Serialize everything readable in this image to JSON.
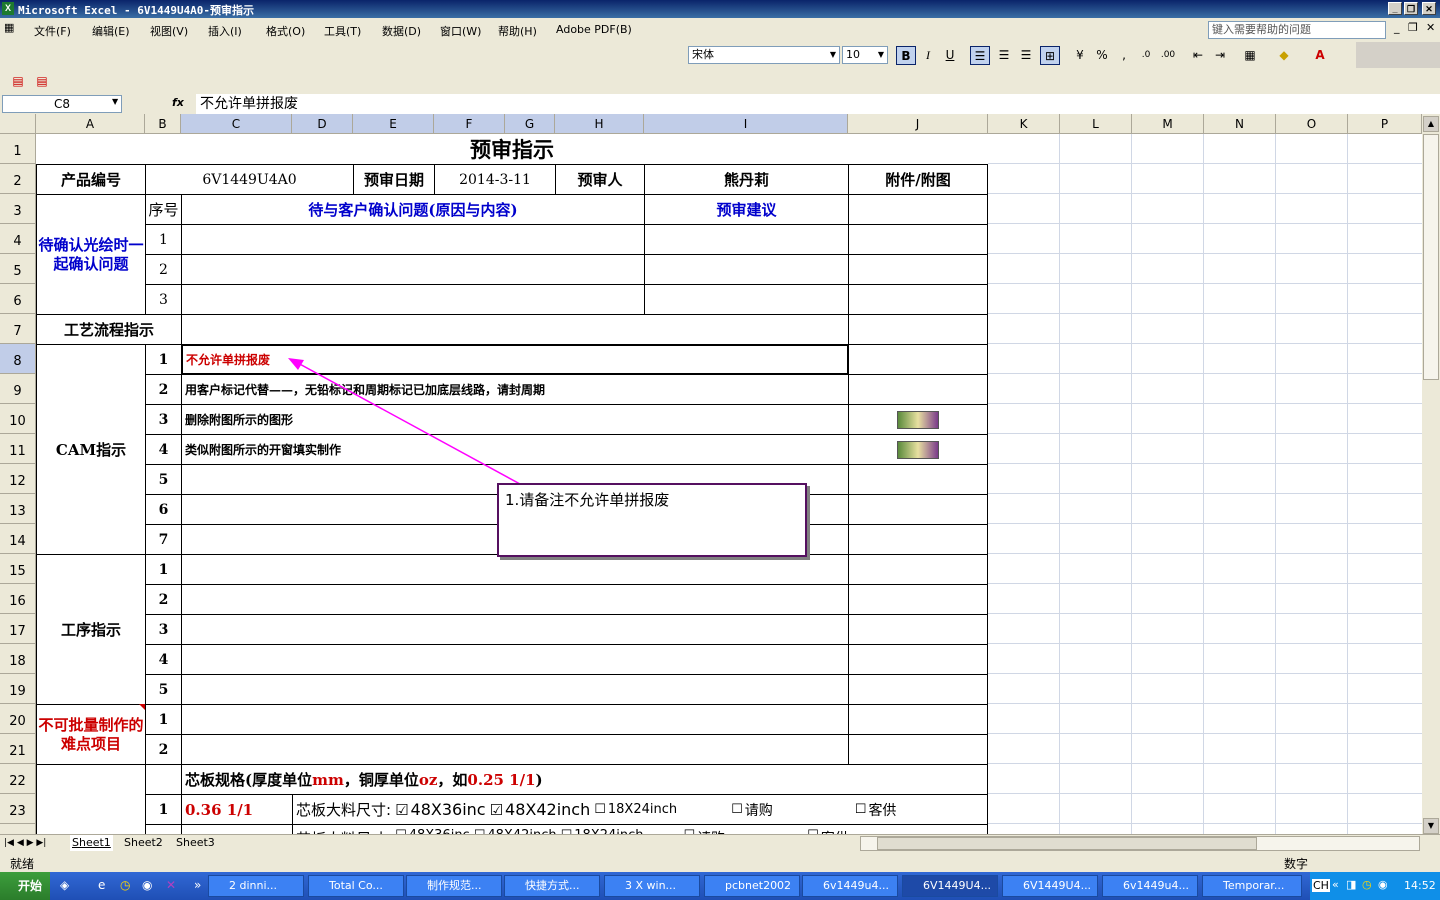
{
  "window": {
    "title": "Microsoft Excel - 6V1449U4A0-预审指示",
    "app_icon": "excel-icon"
  },
  "menu": {
    "items": [
      "文件(F)",
      "编辑(E)",
      "视图(V)",
      "插入(I)",
      "格式(O)",
      "工具(T)",
      "数据(D)",
      "窗口(W)",
      "帮助(H)",
      "Adobe PDF(B)"
    ],
    "help_placeholder": "键入需要帮助的问题"
  },
  "format_toolbar": {
    "font": "宋体",
    "size": "10",
    "bold": "B",
    "italic": "I",
    "underline": "U",
    "percent": "%",
    "comma": ","
  },
  "formula_bar": {
    "name_box": "C8",
    "fx": "fx",
    "content": "不允许单拼报废"
  },
  "columns": [
    "A",
    "B",
    "C",
    "D",
    "E",
    "F",
    "G",
    "H",
    "I",
    "J",
    "K",
    "L",
    "M",
    "N",
    "O",
    "P"
  ],
  "rows": [
    "1",
    "2",
    "3",
    "4",
    "5",
    "6",
    "7",
    "8",
    "9",
    "10",
    "11",
    "12",
    "13",
    "14",
    "15",
    "16",
    "17",
    "18",
    "19",
    "20",
    "21",
    "22",
    "23"
  ],
  "sheet": {
    "title": "预审指示",
    "product_label": "产品编号",
    "product_value": "6V1449U4A0",
    "date_label": "预审日期",
    "date_value": "2014-3-11",
    "reviewer_label": "预审人",
    "reviewer_value": "熊丹莉",
    "attachment_label": "附件/附图",
    "seq_label": "序号",
    "issue_header": "待与客户确认问题(原因与内容)",
    "suggest_header": "预审建议",
    "confirm_section": "待确认光绘时一起确认问题",
    "process_label": "工艺流程指示",
    "cam_section": "CAM指示",
    "cam_items": [
      "不允许单拼报废",
      "用客户标记代替——，无铅标记和周期标记已加底层线路，请封周期",
      "删除附图所示的图形",
      "类似附图所示的开窗填实制作"
    ],
    "proc_section": "工序指示",
    "hard_section": "不可批量制作的难点项目",
    "core_header_a": "芯板规格(厚度单位",
    "core_header_mm": "mm",
    "core_header_b": "，铜厚单位",
    "core_header_oz": "oz",
    "core_header_c": "，如",
    "core_header_ex": "0.25 1/1",
    "core_header_d": ")",
    "core_row1_no": "1",
    "core_row1_spec": "0.36 1/1",
    "core_size_label": "芯板大料尺寸:",
    "opt1": "48X36inc",
    "opt2": "48X42inch",
    "opt3": "18X24inch",
    "opt4": "请购",
    "opt5": "客供",
    "checkbox_checked": "☑",
    "checkbox_empty": "☐"
  },
  "comment": {
    "text": "1.请备注不允许单拼报废",
    "border_color": "#551060",
    "arrow_color": "#ff00ff"
  },
  "tabs": [
    "Sheet1",
    "Sheet2",
    "Sheet3"
  ],
  "status": {
    "ready": "就绪",
    "mode": "数字"
  },
  "taskbar": {
    "start": "开始",
    "items": [
      "2 dinni...",
      "Total Co...",
      "制作规范...",
      "快捷方式...",
      "3 X win...",
      "pcbnet2002",
      "6v1449u4...",
      "6V1449U4...",
      "6V1449U4...",
      "6v1449u4...",
      "Temporar..."
    ],
    "clock": "14:52",
    "lang": "CH"
  }
}
